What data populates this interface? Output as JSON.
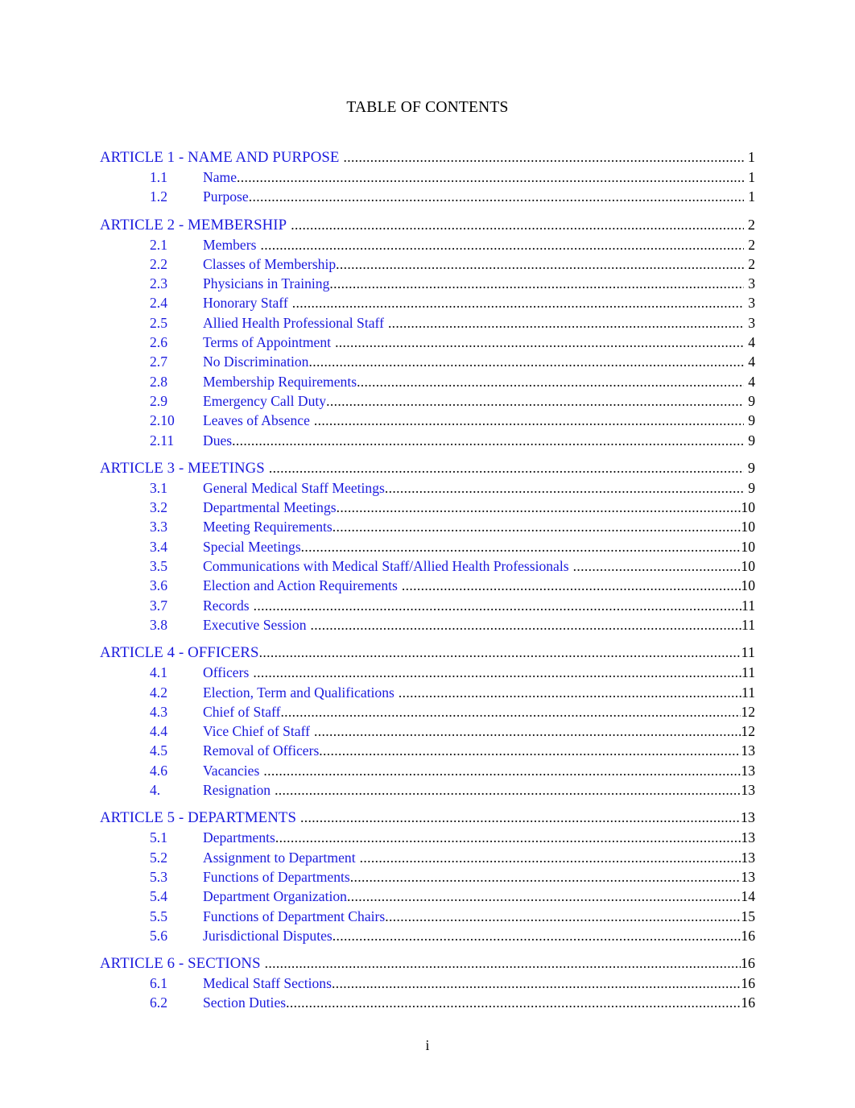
{
  "document": {
    "heading": "TABLE OF CONTENTS",
    "folio": "i",
    "colors": {
      "entry_blue": "#1b1bdd",
      "leader_black": "#111111",
      "page_number_black": "#000000",
      "heading_black": "#000000",
      "page_background": "#ffffff"
    }
  },
  "toc": {
    "entries": [
      {
        "level": "article",
        "num": "",
        "title": "ARTICLE 1 - NAME AND PURPOSE",
        "page": "1"
      },
      {
        "level": "section",
        "num": "1.1",
        "title": "Name",
        "page": "1"
      },
      {
        "level": "section",
        "num": "1.2",
        "title": "Purpose",
        "page": "1"
      },
      {
        "level": "article",
        "num": "",
        "title": "ARTICLE 2 - MEMBERSHIP",
        "page": "2"
      },
      {
        "level": "section",
        "num": "2.1",
        "title": "Members",
        "page": "2"
      },
      {
        "level": "section",
        "num": "2.2",
        "title": "Classes of Membership",
        "page": "2"
      },
      {
        "level": "section",
        "num": "2.3",
        "title": "Physicians in Training",
        "page": "3"
      },
      {
        "level": "section",
        "num": "2.4",
        "title": "Honorary Staff",
        "page": "3"
      },
      {
        "level": "section",
        "num": "2.5",
        "title": "Allied Health Professional Staff",
        "page": "3"
      },
      {
        "level": "section",
        "num": "2.6",
        "title": "Terms of Appointment",
        "page": "4"
      },
      {
        "level": "section",
        "num": "2.7",
        "title": "No Discrimination",
        "page": "4"
      },
      {
        "level": "section",
        "num": "2.8",
        "title": "Membership Requirements",
        "page": "4"
      },
      {
        "level": "section",
        "num": "2.9",
        "title": "Emergency Call Duty",
        "page": "9"
      },
      {
        "level": "section",
        "num": "2.10",
        "title": "Leaves of Absence",
        "page": "9"
      },
      {
        "level": "section",
        "num": "2.11",
        "title": "Dues",
        "page": "9"
      },
      {
        "level": "article",
        "num": "",
        "title": "ARTICLE 3 - MEETINGS",
        "page": "9"
      },
      {
        "level": "section",
        "num": "3.1",
        "title": "General Medical Staff Meetings",
        "page": "9"
      },
      {
        "level": "section",
        "num": "3.2",
        "title": "Departmental Meetings",
        "page": "10"
      },
      {
        "level": "section",
        "num": "3.3",
        "title": "Meeting Requirements",
        "page": "10"
      },
      {
        "level": "section",
        "num": "3.4",
        "title": "Special Meetings",
        "page": "10"
      },
      {
        "level": "section",
        "num": "3.5",
        "title": "Communications with Medical Staff/Allied Health Professionals",
        "page": "10"
      },
      {
        "level": "section",
        "num": "3.6",
        "title": "Election and Action Requirements",
        "page": "10"
      },
      {
        "level": "section",
        "num": "3.7",
        "title": "Records",
        "page": "11"
      },
      {
        "level": "section",
        "num": "3.8",
        "title": "Executive Session",
        "page": "11"
      },
      {
        "level": "article",
        "num": "",
        "title": "ARTICLE 4 - OFFICERS",
        "page": "11"
      },
      {
        "level": "section",
        "num": "4.1",
        "title": "Officers",
        "page": "11"
      },
      {
        "level": "section",
        "num": "4.2",
        "title": "Election, Term and Qualifications",
        "page": "11"
      },
      {
        "level": "section",
        "num": "4.3",
        "title": "Chief of Staff",
        "page": "12"
      },
      {
        "level": "section",
        "num": "4.4",
        "title": "Vice Chief of Staff",
        "page": "12"
      },
      {
        "level": "section",
        "num": "4.5",
        "title": "Removal of Officers",
        "page": "13"
      },
      {
        "level": "section",
        "num": "4.6",
        "title": "Vacancies",
        "page": "13"
      },
      {
        "level": "section",
        "num": "4.",
        "title": "Resignation",
        "page": "13"
      },
      {
        "level": "article",
        "num": "",
        "title": "ARTICLE 5 - DEPARTMENTS",
        "page": "13"
      },
      {
        "level": "section",
        "num": "5.1",
        "title": "Departments",
        "page": "13"
      },
      {
        "level": "section",
        "num": "5.2",
        "title": "Assignment to Department",
        "page": "13"
      },
      {
        "level": "section",
        "num": "5.3",
        "title": "Functions of Departments",
        "page": "13"
      },
      {
        "level": "section",
        "num": "5.4",
        "title": "Department Organization",
        "page": "14"
      },
      {
        "level": "section",
        "num": "5.5",
        "title": "Functions of Department Chairs",
        "page": "15"
      },
      {
        "level": "section",
        "num": "5.6",
        "title": "Jurisdictional Disputes",
        "page": "16"
      },
      {
        "level": "article",
        "num": "",
        "title": "ARTICLE 6 - SECTIONS",
        "page": "16"
      },
      {
        "level": "section",
        "num": "6.1",
        "title": "Medical Staff Sections",
        "page": "16"
      },
      {
        "level": "section",
        "num": "6.2",
        "title": "Section Duties",
        "page": "16"
      }
    ]
  }
}
